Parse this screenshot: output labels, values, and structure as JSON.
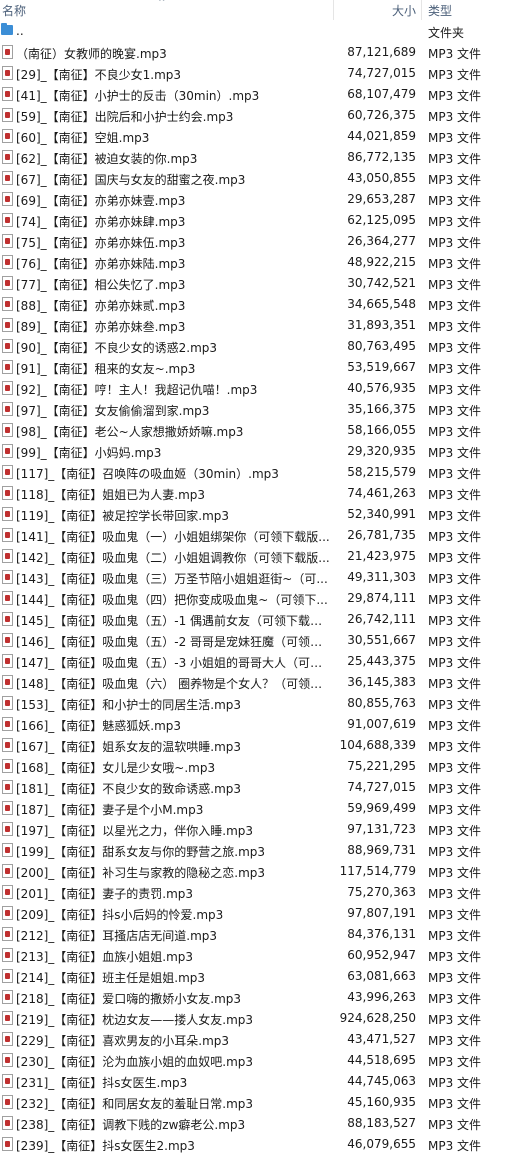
{
  "header": {
    "name_label": "名称",
    "size_label": "大小",
    "type_label": "类型",
    "sort_caret": "^"
  },
  "parent_row": {
    "name": "..",
    "type": "文件夹"
  },
  "files": [
    {
      "name": "（南征）女教师的晚宴.mp3",
      "size": "87,121,689",
      "type": "MP3 文件"
    },
    {
      "name": "[29]_【南征】不良少女1.mp3",
      "size": "74,727,015",
      "type": "MP3 文件"
    },
    {
      "name": "[41]_【南征】小护士的反击（30min）.mp3",
      "size": "68,107,479",
      "type": "MP3 文件"
    },
    {
      "name": "[59]_【南征】出院后和小护士约会.mp3",
      "size": "60,726,375",
      "type": "MP3 文件"
    },
    {
      "name": "[60]_【南征】空姐.mp3",
      "size": "44,021,859",
      "type": "MP3 文件"
    },
    {
      "name": "[62]_【南征】被迫女装的你.mp3",
      "size": "86,772,135",
      "type": "MP3 文件"
    },
    {
      "name": "[67]_【南征】国庆与女友的甜蜜之夜.mp3",
      "size": "43,050,855",
      "type": "MP3 文件"
    },
    {
      "name": "[69]_【南征】亦弟亦妹壹.mp3",
      "size": "29,653,287",
      "type": "MP3 文件"
    },
    {
      "name": "[74]_【南征】亦弟亦妹肆.mp3",
      "size": "62,125,095",
      "type": "MP3 文件"
    },
    {
      "name": "[75]_【南征】亦弟亦妹伍.mp3",
      "size": "26,364,277",
      "type": "MP3 文件"
    },
    {
      "name": "[76]_【南征】亦弟亦妹陆.mp3",
      "size": "48,922,215",
      "type": "MP3 文件"
    },
    {
      "name": "[77]_【南征】相公失忆了.mp3",
      "size": "30,742,521",
      "type": "MP3 文件"
    },
    {
      "name": "[88]_【南征】亦弟亦妹贰.mp3",
      "size": "34,665,548",
      "type": "MP3 文件"
    },
    {
      "name": "[89]_【南征】亦弟亦妹叁.mp3",
      "size": "31,893,351",
      "type": "MP3 文件"
    },
    {
      "name": "[90]_【南征】不良少女的诱惑2.mp3",
      "size": "80,763,495",
      "type": "MP3 文件"
    },
    {
      "name": "[91]_【南征】租来的女友~.mp3",
      "size": "53,519,667",
      "type": "MP3 文件"
    },
    {
      "name": "[92]_【南征】哼！主人！我超记仇喵！.mp3",
      "size": "40,576,935",
      "type": "MP3 文件"
    },
    {
      "name": "[97]_【南征】女友偷偷溜到家.mp3",
      "size": "35,166,375",
      "type": "MP3 文件"
    },
    {
      "name": "[98]_【南征】老公~人家想撒娇娇嘛.mp3",
      "size": "58,166,055",
      "type": "MP3 文件"
    },
    {
      "name": "[99]_【南征】小妈妈.mp3",
      "size": "29,320,935",
      "type": "MP3 文件"
    },
    {
      "name": "[117]_【南征】召唤阵の吸血姬（30min）.mp3",
      "size": "58,215,579",
      "type": "MP3 文件"
    },
    {
      "name": "[118]_【南征】姐姐已为人妻.mp3",
      "size": "74,461,263",
      "type": "MP3 文件"
    },
    {
      "name": "[119]_【南征】被足控学长带回家.mp3",
      "size": "52,340,991",
      "type": "MP3 文件"
    },
    {
      "name": "[141]_【南征】吸血鬼（一）小姐姐绑架你（可领下载版...",
      "size": "26,781,735",
      "type": "MP3 文件"
    },
    {
      "name": "[142]_【南征】吸血鬼（二）小姐姐调教你（可领下载版...",
      "size": "21,423,975",
      "type": "MP3 文件"
    },
    {
      "name": "[143]_【南征】吸血鬼（三）万圣节陪小姐姐逛街~（可...",
      "size": "49,311,303",
      "type": "MP3 文件"
    },
    {
      "name": "[144]_【南征】吸血鬼（四）把你变成吸血鬼~（可领下...",
      "size": "29,874,111",
      "type": "MP3 文件"
    },
    {
      "name": "[145]_【南征】吸血鬼（五）-1 偶遇前女友（可领下载版...",
      "size": "26,742,111",
      "type": "MP3 文件"
    },
    {
      "name": "[146]_【南征】吸血鬼（五）-2 哥哥是宠妹狂魔（可领下...",
      "size": "30,551,667",
      "type": "MP3 文件"
    },
    {
      "name": "[147]_【南征】吸血鬼（五）-3 小姐姐的哥哥大人（可领...",
      "size": "25,443,375",
      "type": "MP3 文件"
    },
    {
      "name": "[148]_【南征】吸血鬼（六） 圈养物是个女人？（可领下...",
      "size": "36,145,383",
      "type": "MP3 文件"
    },
    {
      "name": "[153]_【南征】和小护士的同居生活.mp3",
      "size": "80,855,763",
      "type": "MP3 文件"
    },
    {
      "name": "[166]_【南征】魅惑狐妖.mp3",
      "size": "91,007,619",
      "type": "MP3 文件"
    },
    {
      "name": "[167]_【南征】姐系女友的温软哄睡.mp3",
      "size": "104,688,339",
      "type": "MP3 文件"
    },
    {
      "name": "[168]_【南征】女儿是少女哦~.mp3",
      "size": "75,221,295",
      "type": "MP3 文件"
    },
    {
      "name": "[181]_【南征】不良少女的致命诱惑.mp3",
      "size": "74,727,015",
      "type": "MP3 文件"
    },
    {
      "name": "[187]_【南征】妻子是个小M.mp3",
      "size": "59,969,499",
      "type": "MP3 文件"
    },
    {
      "name": "[197]_【南征】以星光之力，伴你入睡.mp3",
      "size": "97,131,723",
      "type": "MP3 文件"
    },
    {
      "name": "[199]_【南征】甜系女友与你的野营之旅.mp3",
      "size": "88,969,731",
      "type": "MP3 文件"
    },
    {
      "name": "[200]_【南征】补习生与家教的隐秘之恋.mp3",
      "size": "117,514,779",
      "type": "MP3 文件"
    },
    {
      "name": "[201]_【南征】妻子的责罚.mp3",
      "size": "75,270,363",
      "type": "MP3 文件"
    },
    {
      "name": "[209]_【南征】抖s小后妈的怜爱.mp3",
      "size": "97,807,191",
      "type": "MP3 文件"
    },
    {
      "name": "[212]_【南征】耳搔店店无间道.mp3",
      "size": "84,376,131",
      "type": "MP3 文件"
    },
    {
      "name": "[213]_【南征】血族小姐姐.mp3",
      "size": "60,952,947",
      "type": "MP3 文件"
    },
    {
      "name": "[214]_【南征】班主任是姐姐.mp3",
      "size": "63,081,663",
      "type": "MP3 文件"
    },
    {
      "name": "[218]_【南征】爱口嗨的撒娇小女友.mp3",
      "size": "43,996,263",
      "type": "MP3 文件"
    },
    {
      "name": "[219]_【南征】枕边女友——搂人女友.mp3",
      "size": "924,628,250",
      "type": "MP3 文件"
    },
    {
      "name": "[229]_【南征】喜欢男友的小耳朵.mp3",
      "size": "43,471,527",
      "type": "MP3 文件"
    },
    {
      "name": "[230]_【南征】沦为血族小姐的血奴吧.mp3",
      "size": "44,518,695",
      "type": "MP3 文件"
    },
    {
      "name": "[231]_【南征】抖s女医生.mp3",
      "size": "44,745,063",
      "type": "MP3 文件"
    },
    {
      "name": "[232]_【南征】和同居女友的羞耻日常.mp3",
      "size": "45,160,935",
      "type": "MP3 文件"
    },
    {
      "name": "[238]_【南征】调教下贱的zw癖老公.mp3",
      "size": "88,183,527",
      "type": "MP3 文件"
    },
    {
      "name": "[239]_【南征】抖s女医生2.mp3",
      "size": "46,079,655",
      "type": "MP3 文件"
    }
  ]
}
